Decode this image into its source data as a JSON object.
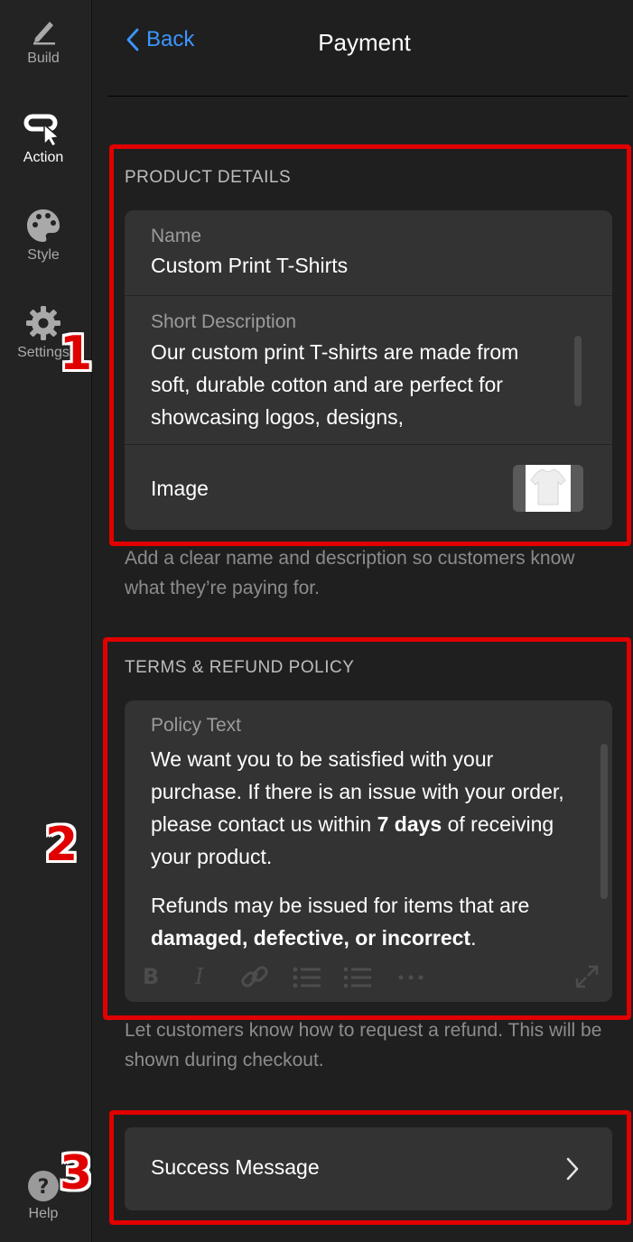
{
  "sidebar": {
    "items": [
      {
        "label": "Build",
        "icon": "pencil-icon"
      },
      {
        "label": "Action",
        "icon": "cursor-click-icon"
      },
      {
        "label": "Style",
        "icon": "palette-icon"
      },
      {
        "label": "Settings",
        "icon": "gear-icon"
      }
    ],
    "help": {
      "label": "Help",
      "icon": "question-icon"
    }
  },
  "header": {
    "back_label": "Back",
    "title": "Payment"
  },
  "product_details": {
    "section_title": "PRODUCT DETAILS",
    "name_label": "Name",
    "name_value": "Custom Print T-Shirts",
    "description_label": "Short Description",
    "description_value": "Our custom print T-shirts are made from soft, durable cotton and are perfect for showcasing logos, designs,",
    "image_label": "Image",
    "helper_text": "Add a clear name and description so customers know what they’re paying for."
  },
  "terms": {
    "section_title": "TERMS & REFUND POLICY",
    "policy_label": "Policy Text",
    "p1_a": "We want you to be satisfied with your purchase. If there is an issue with your order, please contact us within ",
    "p1_bold": "7 days",
    "p1_b": " of receiving your product.",
    "p2_a": "Refunds may be issued for items that are ",
    "p2_bold": "damaged, defective, or incorrect",
    "p2_b": ".",
    "helper_text": "Let customers know how to request a refund. This will be shown during checkout."
  },
  "success": {
    "label": "Success Message"
  },
  "annotations": [
    "1",
    "2",
    "3"
  ],
  "colors": {
    "accent": "#3b96ff",
    "highlight": "#e00000"
  }
}
